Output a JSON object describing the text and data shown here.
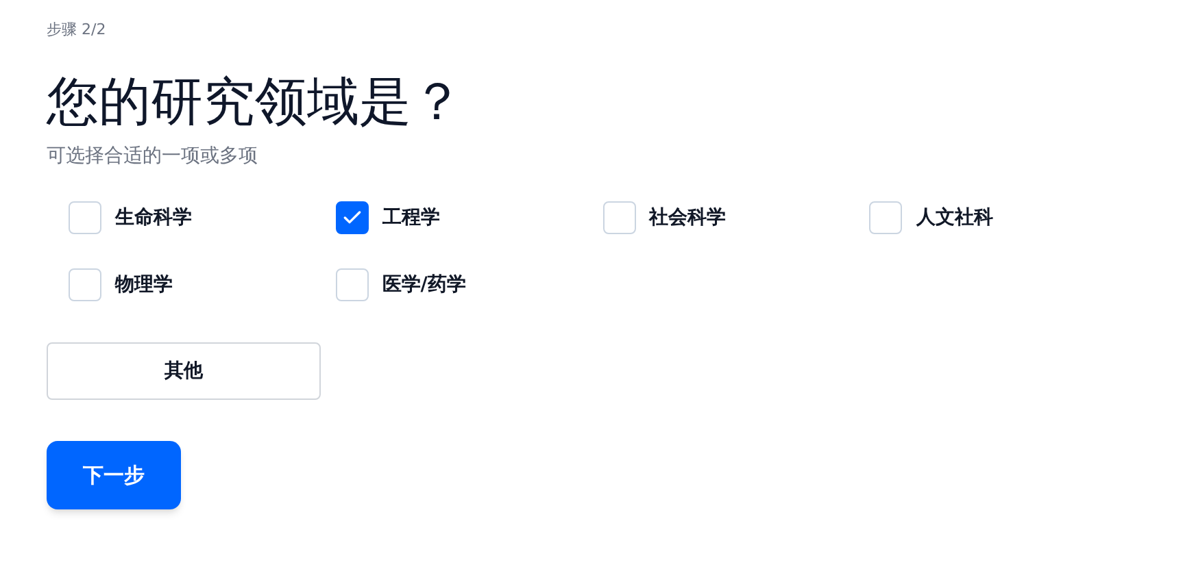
{
  "step": "步骤 2/2",
  "title": "您的研究领域是？",
  "subtitle": "可选择合适的一项或多项",
  "options": [
    {
      "label": "生命科学",
      "checked": false
    },
    {
      "label": "工程学",
      "checked": true
    },
    {
      "label": "社会科学",
      "checked": false
    },
    {
      "label": "人文社科",
      "checked": false
    },
    {
      "label": "物理学",
      "checked": false
    },
    {
      "label": "医学/药学",
      "checked": false
    }
  ],
  "other_button": "其他",
  "next_button": "下一步"
}
